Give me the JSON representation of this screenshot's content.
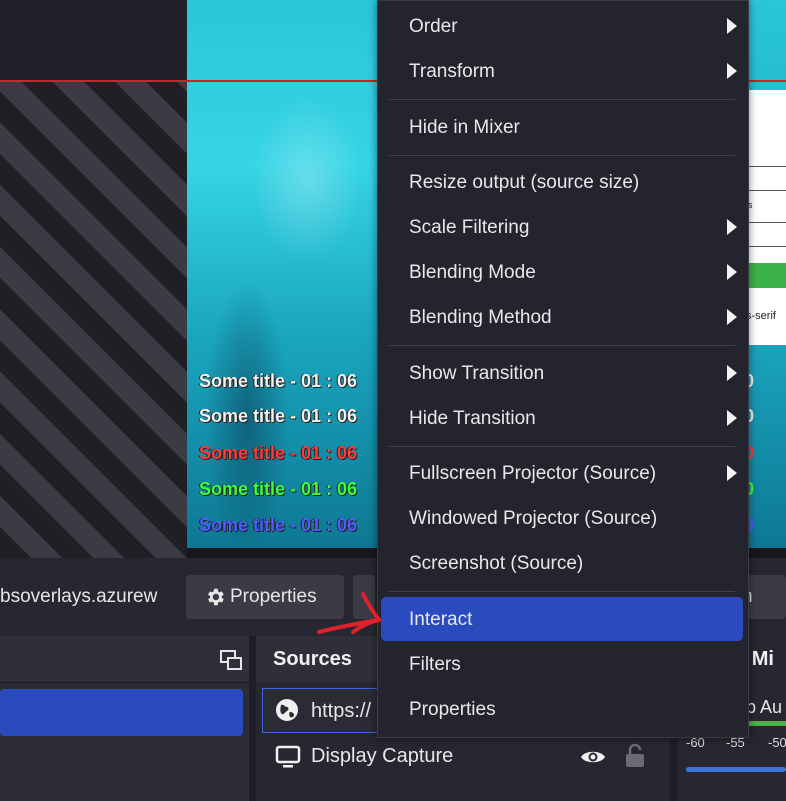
{
  "preview": {
    "overlay_titles": [
      {
        "text": "Some title - 01 : 06",
        "color": "#f2f2f2"
      },
      {
        "text": "Some title - 01 : 06",
        "color": "#f2f2f2"
      },
      {
        "text": "Some title - 01 : 06",
        "color": "#ff3b3b"
      },
      {
        "text": "Some title - 01 : 06",
        "color": "#3cff3c"
      },
      {
        "text": "Some title - 01 : 06",
        "color": "#4f5cff"
      }
    ],
    "right_digits": [
      "0",
      "0",
      "0",
      "0",
      "0"
    ],
    "side_panel_text": [
      "s",
      "s-serif"
    ]
  },
  "toolbar": {
    "source_url": "bsoverlays.azurew",
    "properties_label": "Properties",
    "right_button_label": "h"
  },
  "docks": {
    "sources_title": "Sources",
    "sources": [
      {
        "label": "https://",
        "icon": "globe-icon"
      },
      {
        "label": "Display Capture",
        "icon": "monitor-icon"
      }
    ],
    "mixer_title": "o Mi",
    "mixer_item": "p Au",
    "mixer_ticks": [
      "-60",
      "-55",
      "-50"
    ]
  },
  "context_menu": {
    "items": [
      {
        "label": "Order",
        "submenu": true
      },
      {
        "label": "Transform",
        "submenu": true
      },
      {
        "label": "Hide in Mixer",
        "submenu": false
      },
      {
        "label": "Resize output (source size)",
        "submenu": false
      },
      {
        "label": "Scale Filtering",
        "submenu": true
      },
      {
        "label": "Blending Mode",
        "submenu": true
      },
      {
        "label": "Blending Method",
        "submenu": true
      },
      {
        "label": "Show Transition",
        "submenu": true
      },
      {
        "label": "Hide Transition",
        "submenu": true
      },
      {
        "label": "Fullscreen Projector (Source)",
        "submenu": true
      },
      {
        "label": "Windowed Projector (Source)",
        "submenu": false
      },
      {
        "label": "Screenshot (Source)",
        "submenu": false
      },
      {
        "label": "Interact",
        "submenu": false,
        "highlighted": true
      },
      {
        "label": "Filters",
        "submenu": false
      },
      {
        "label": "Properties",
        "submenu": false
      }
    ]
  },
  "colors": {
    "accent": "#2a4bbd",
    "annotation_arrow": "#e0202a"
  }
}
